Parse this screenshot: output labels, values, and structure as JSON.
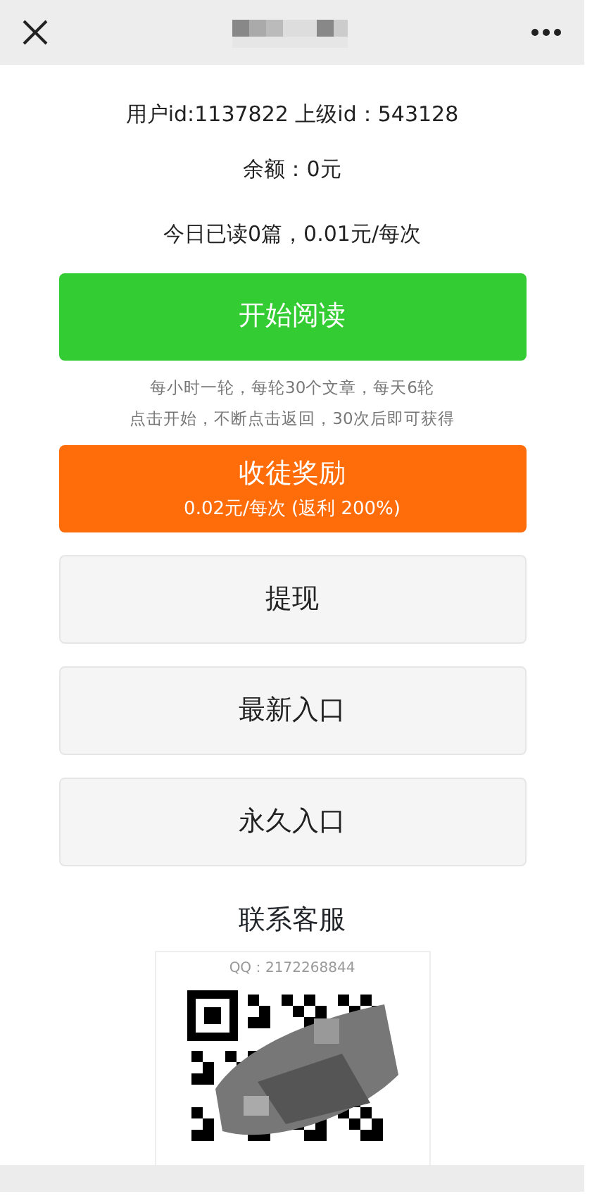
{
  "info_lines": [
    "用户id:1137822 上级id：543128",
    "余额：0元",
    "今日已读0篇，0.01元/每次"
  ],
  "buttons": [
    {
      "kind": "primary",
      "color": "#33cc33",
      "label": "开始阅读"
    },
    {
      "kind": "note",
      "lines": [
        "每小时一轮，每轮30个文章，每天6轮",
        "点击开始，不断点击返回，30次后即可获得"
      ]
    },
    {
      "kind": "reward",
      "color": "#ff6d0b",
      "label": "收徒奖励",
      "sub": "0.02元/每次 (返利 200%)"
    },
    {
      "kind": "plain",
      "label": "提现"
    },
    {
      "kind": "plain",
      "label": "最新入口"
    },
    {
      "kind": "plain",
      "label": "永久入口"
    }
  ],
  "contact": {
    "title": "联系客服",
    "qq": "QQ：2172268844"
  }
}
